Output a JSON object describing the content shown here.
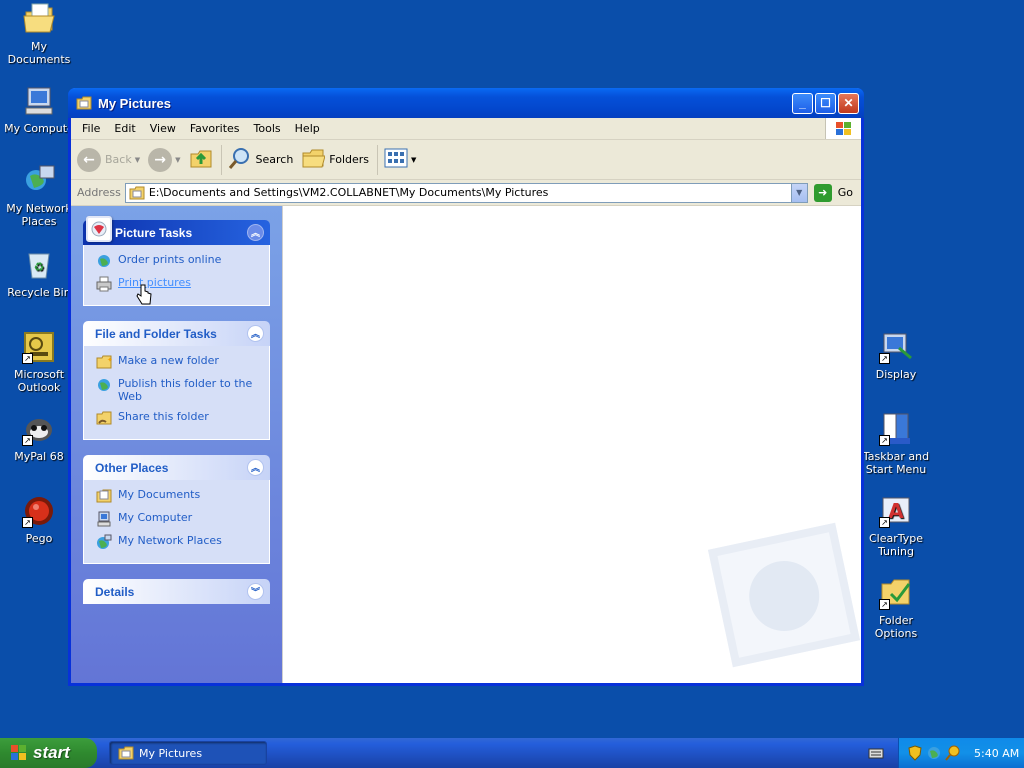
{
  "desktop": {
    "left_icons": [
      {
        "label": "My Documents",
        "icon": "my-documents-icon"
      },
      {
        "label": "My Compute",
        "icon": "my-computer-icon"
      },
      {
        "label": "My Network Places",
        "icon": "network-places-icon"
      },
      {
        "label": "Recycle Bin",
        "icon": "recycle-bin-icon"
      },
      {
        "label": "Microsoft Outlook",
        "icon": "outlook-icon"
      },
      {
        "label": "MyPal 68",
        "icon": "mypal-icon"
      },
      {
        "label": "Pego",
        "icon": "pego-icon"
      }
    ],
    "right_icons": [
      {
        "label": "Display",
        "icon": "display-icon"
      },
      {
        "label": "Taskbar and Start Menu",
        "icon": "taskbar-start-menu-icon"
      },
      {
        "label": "ClearType Tuning",
        "icon": "cleartype-icon"
      },
      {
        "label": "Folder Options",
        "icon": "folder-options-icon"
      }
    ]
  },
  "window": {
    "title": "My Pictures",
    "menu": [
      "File",
      "Edit",
      "View",
      "Favorites",
      "Tools",
      "Help"
    ],
    "toolbar": {
      "back": "Back",
      "search": "Search",
      "folders": "Folders"
    },
    "address": {
      "label": "Address",
      "value": "E:\\Documents and Settings\\VM2.COLLABNET\\My Documents\\My Pictures",
      "go": "Go"
    },
    "taskpane": {
      "picture_tasks": {
        "title": "Picture Tasks",
        "items": [
          "Order prints online",
          "Print pictures"
        ]
      },
      "file_folder_tasks": {
        "title": "File and Folder Tasks",
        "items": [
          "Make a new folder",
          "Publish this folder to the Web",
          "Share this folder"
        ]
      },
      "other_places": {
        "title": "Other Places",
        "items": [
          "My Documents",
          "My Computer",
          "My Network Places"
        ]
      },
      "details": {
        "title": "Details"
      }
    }
  },
  "taskbar": {
    "start": "start",
    "task_button": "My Pictures",
    "clock": "5:40 AM"
  },
  "colors": {
    "desktop": "#0a4eaa",
    "titlebar": "#0550d8",
    "taskpane_link": "#215dc6",
    "start_green": "#2f8a2f"
  }
}
